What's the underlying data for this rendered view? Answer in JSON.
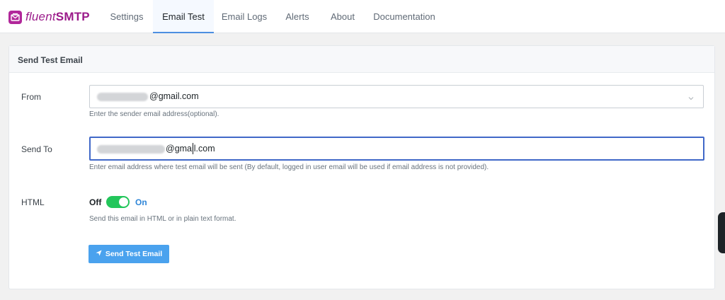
{
  "brand": {
    "name_part1": "fluent",
    "name_part2": "SMTP",
    "color": "#9b1b8a"
  },
  "nav": {
    "tabs": [
      {
        "label": "Settings",
        "active": false
      },
      {
        "label": "Email Test",
        "active": true
      },
      {
        "label": "Email Logs",
        "active": false
      },
      {
        "label": "Alerts",
        "active": false
      },
      {
        "label": "About",
        "active": false
      },
      {
        "label": "Documentation",
        "active": false
      }
    ]
  },
  "card": {
    "title": "Send Test Email"
  },
  "form": {
    "from": {
      "label": "From",
      "value_suffix": "@gmail.com",
      "help": "Enter the sender email address(optional).",
      "icon": "chevron-down-icon"
    },
    "send_to": {
      "label": "Send To",
      "value_suffix": "@gmail.com",
      "help": "Enter email address where test email will be sent (By default, logged in user email will be used if email address is not provided)."
    },
    "html": {
      "label": "HTML",
      "off_label": "Off",
      "on_label": "On",
      "enabled": true,
      "help": "Send this email in HTML or in plain text format."
    },
    "submit": {
      "label": "Send Test Email",
      "icon": "paper-plane-icon",
      "color": "#4aa2ee"
    }
  },
  "colors": {
    "toggle_on": "#23c65b",
    "focus_border": "#4068c8",
    "active_tab_underline": "#4d8fe0"
  }
}
